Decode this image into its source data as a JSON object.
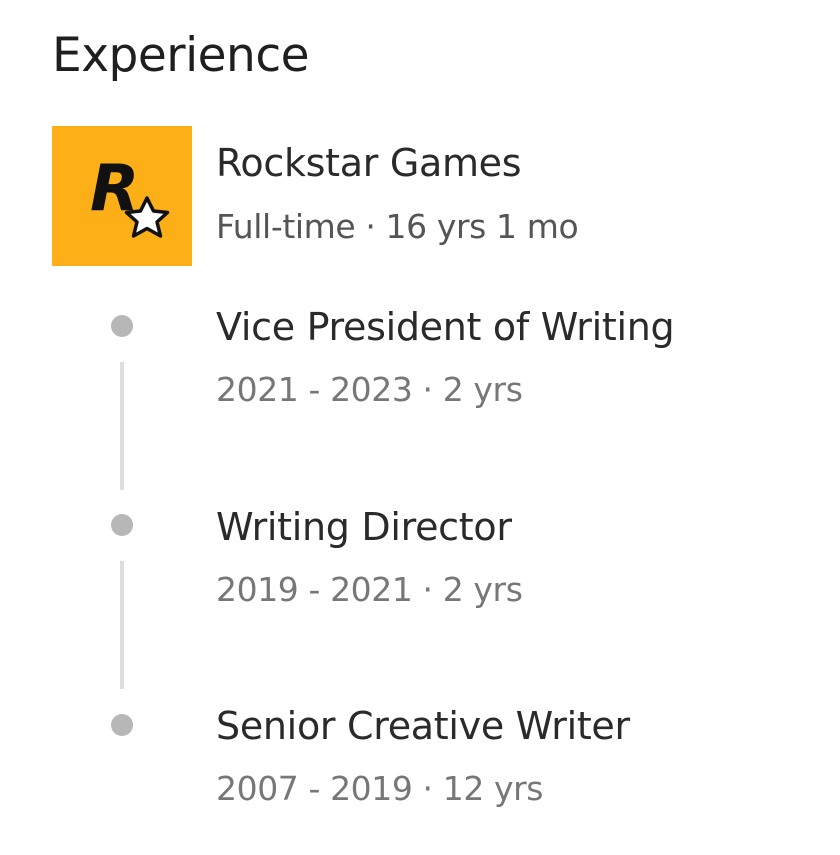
{
  "section": {
    "title": "Experience"
  },
  "company": {
    "name": "Rockstar Games",
    "meta": "Full-time · 16 yrs 1 mo",
    "logo_text": "R",
    "logo_icon": "rockstar-logo-icon",
    "logo_color": "#fcaf17"
  },
  "roles": [
    {
      "title": "Vice President of Writing",
      "dates": "2021 - 2023 · 2 yrs"
    },
    {
      "title": "Writing Director",
      "dates": "2019 - 2021 · 2 yrs"
    },
    {
      "title": "Senior Creative Writer",
      "dates": "2007 - 2019 · 12 yrs"
    }
  ]
}
